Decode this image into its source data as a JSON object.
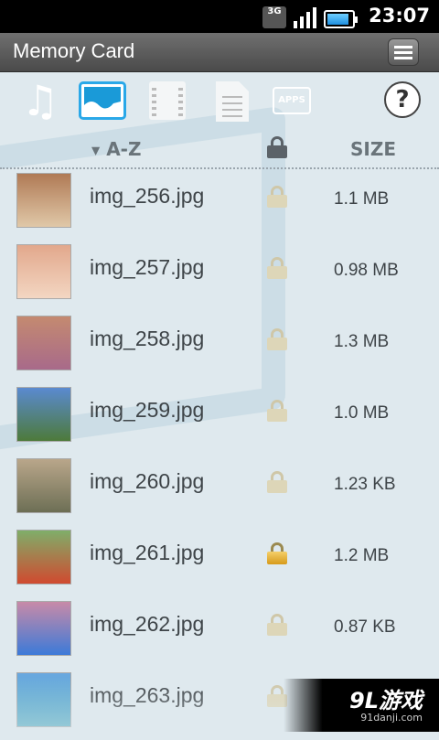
{
  "status_bar": {
    "network": "3G",
    "time": "23:07"
  },
  "title_bar": {
    "title": "Memory Card"
  },
  "toolbar": {
    "categories": [
      {
        "name": "music",
        "icon": "music-note-icon"
      },
      {
        "name": "images",
        "icon": "image-icon",
        "selected": true
      },
      {
        "name": "video",
        "icon": "film-icon"
      },
      {
        "name": "documents",
        "icon": "document-icon"
      },
      {
        "name": "apps",
        "icon": "apps-icon",
        "label": "APPS"
      }
    ],
    "help_label": "?"
  },
  "columns": {
    "name": "A-Z",
    "size": "SIZE"
  },
  "files": [
    {
      "name": "img_256.jpg",
      "size": "1.1 MB",
      "locked": false,
      "thumb": [
        "#b07a55",
        "#e0c8a8"
      ]
    },
    {
      "name": "img_257.jpg",
      "size": "0.98 MB",
      "locked": false,
      "thumb": [
        "#e2a88c",
        "#f3d6c2"
      ]
    },
    {
      "name": "img_258.jpg",
      "size": "1.3 MB",
      "locked": false,
      "thumb": [
        "#c48a70",
        "#a86a8a"
      ]
    },
    {
      "name": "img_259.jpg",
      "size": "1.0 MB",
      "locked": false,
      "thumb": [
        "#5a8ad0",
        "#4d7a3a"
      ]
    },
    {
      "name": "img_260.jpg",
      "size": "1.23 KB",
      "locked": false,
      "thumb": [
        "#b9a68a",
        "#6d6f55"
      ]
    },
    {
      "name": "img_261.jpg",
      "size": "1.2 MB",
      "locked": true,
      "thumb": [
        "#7fae6a",
        "#d04a30"
      ]
    },
    {
      "name": "img_262.jpg",
      "size": "0.87 KB",
      "locked": false,
      "thumb": [
        "#c88aa8",
        "#3c7ad8"
      ]
    },
    {
      "name": "img_263.jpg",
      "size": "",
      "locked": false,
      "thumb": [
        "#6aa8e0",
        "#4aa8c0"
      ]
    }
  ],
  "watermark": {
    "brand": "9L游戏",
    "site": "91danji.com"
  },
  "colors": {
    "accent": "#2aa8e8",
    "title_bar": "#5a5a5a",
    "background": "#dfe9ee"
  }
}
